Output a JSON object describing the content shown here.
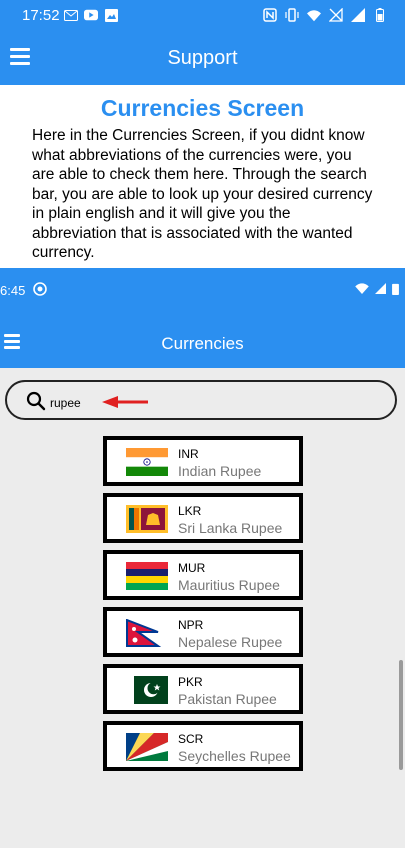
{
  "status_bar": {
    "time": "17:52",
    "left_icons": [
      "mail-icon",
      "youtube-icon",
      "image-icon"
    ],
    "right_icons": [
      "nfc-icon",
      "vibrate-icon",
      "wifi-icon",
      "no-sim-icon",
      "signal-icon",
      "battery-icon"
    ]
  },
  "app_bar": {
    "title": "Support",
    "menu_icon": "hamburger-icon"
  },
  "info": {
    "heading": "Currencies Screen",
    "description": "Here in the Currencies Screen, if you didnt know what abbreviations of the currencies were, you are able to check them here. Through the search bar, you are able to look up your desired currency in plain english and it will give you the abbreviation that is associated with the wanted currency."
  },
  "embedded": {
    "status_time": "6:45",
    "app_title": "Currencies",
    "search": {
      "query": "rupee",
      "icon": "search-icon"
    },
    "currencies": [
      {
        "code": "INR",
        "name": "Indian Rupee",
        "flag": "india"
      },
      {
        "code": "LKR",
        "name": "Sri Lanka Rupee",
        "flag": "sri-lanka"
      },
      {
        "code": "MUR",
        "name": "Mauritius Rupee",
        "flag": "mauritius"
      },
      {
        "code": "NPR",
        "name": "Nepalese Rupee",
        "flag": "nepal"
      },
      {
        "code": "PKR",
        "name": "Pakistan Rupee",
        "flag": "pakistan"
      },
      {
        "code": "SCR",
        "name": "Seychelles Rupee",
        "flag": "seychelles"
      }
    ]
  },
  "colors": {
    "primary": "#2b8ff0",
    "heading": "#2b8ff0",
    "arrow": "#e02020"
  }
}
